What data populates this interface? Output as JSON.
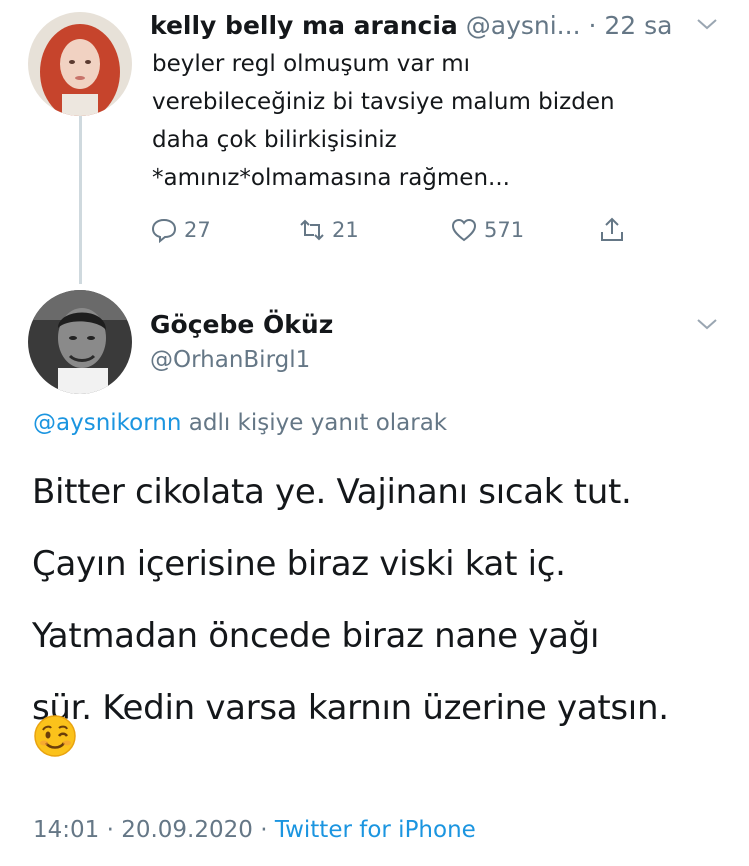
{
  "parent_tweet": {
    "display_name": "kelly belly ma arancia",
    "handle": "@aysni...",
    "separator": "·",
    "time": "22 sa",
    "text_lines": [
      "beyler regl olmuşum var mı",
      "verebileceğiniz bi tavsiye malum bizden",
      "daha çok bilirkişisiniz",
      "*amınız*olmamasına rağmen..."
    ],
    "actions": {
      "reply_count": "27",
      "retweet_count": "21",
      "like_count": "571"
    }
  },
  "reply_tweet": {
    "display_name": "Göçebe Öküz",
    "handle": "@OrhanBirgl1",
    "reply_to_handle": "@aysnikornn",
    "reply_to_suffix": " adlı kişiye yanıt olarak",
    "text_lines": [
      "Bitter cikolata ye. Vajinanı sıcak tut.",
      "Çayın içerisine biraz viski kat iç.",
      "Yatmadan öncede biraz nane yağı",
      "sür. Kedin varsa karnın üzerine yatsın."
    ],
    "emoji": "winking-face",
    "timestamp": "14:01 · 20.09.2020 · ",
    "source": "Twitter for iPhone"
  },
  "colors": {
    "link": "#1b95e0",
    "muted": "#657786",
    "text": "#14171a",
    "thread_line": "#cfd9de"
  }
}
